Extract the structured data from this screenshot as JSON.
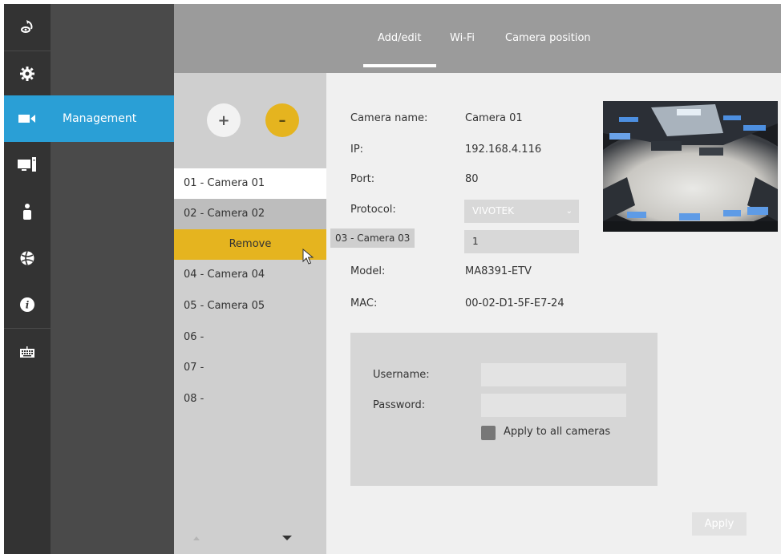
{
  "tabs": [
    "Add/edit",
    "Wi-Fi",
    "Camera position"
  ],
  "subnav": {
    "management": "Management"
  },
  "list": {
    "add_symbol": "+",
    "remove_symbol": "–",
    "cameras": [
      "01 - Camera 01",
      "02 - Camera 02",
      "04 - Camera 04",
      "05 - Camera 05",
      "06 -",
      "07 -",
      "08 -"
    ],
    "remove_label": "Remove",
    "drag_label": "03 - Camera 03"
  },
  "form": {
    "camera_name_label": "Camera name:",
    "camera_name": "Camera 01",
    "ip_label": "IP:",
    "ip": "192.168.4.116",
    "port_label": "Port:",
    "port": "80",
    "protocol_label": "Protocol:",
    "protocol": "VIVOTEK",
    "channel": "1",
    "model_label": "Model:",
    "model": "MA8391-ETV",
    "mac_label": "MAC:",
    "mac": "00-02-D1-5F-E7-24"
  },
  "credentials": {
    "username_label": "Username:",
    "password_label": "Password:",
    "apply_all_label": "Apply to all cameras"
  },
  "apply_label": "Apply",
  "colors": {
    "accent_blue": "#2a9fd6",
    "accent_yellow": "#e5b41f",
    "rail": "#333333"
  },
  "icons": [
    "dewarp-icon",
    "gear-icon",
    "camera-icon",
    "computer-icon",
    "user-icon",
    "globe-icon",
    "info-icon",
    "keyboard-icon"
  ]
}
